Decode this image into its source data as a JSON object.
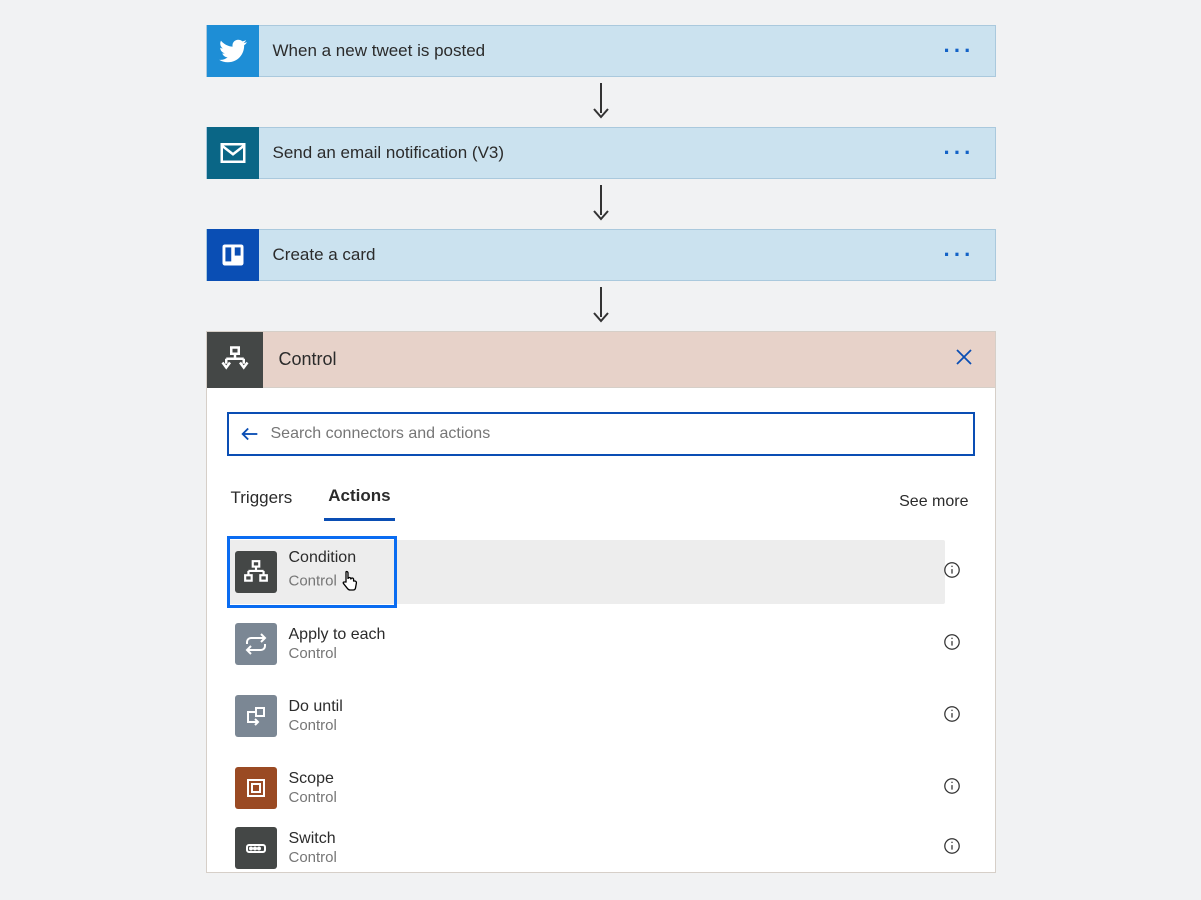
{
  "steps": [
    {
      "label": "When a new tweet is posted",
      "icon": "twitter",
      "bg": "#1e8ed6"
    },
    {
      "label": "Send an email notification (V3)",
      "icon": "mail",
      "bg": "#0a6686"
    },
    {
      "label": "Create a card",
      "icon": "trello",
      "bg": "#0a4eb4"
    }
  ],
  "panel": {
    "title": "Control",
    "search_placeholder": "Search connectors and actions",
    "tabs": {
      "triggers": "Triggers",
      "actions": "Actions"
    },
    "see_more": "See more"
  },
  "actions": [
    {
      "name": "Condition",
      "category": "Control",
      "icon": "condition",
      "bg": "#444746",
      "selected": true
    },
    {
      "name": "Apply to each",
      "category": "Control",
      "icon": "loop",
      "bg": "#7b8794",
      "selected": false
    },
    {
      "name": "Do until",
      "category": "Control",
      "icon": "dountil",
      "bg": "#7b8794",
      "selected": false
    },
    {
      "name": "Scope",
      "category": "Control",
      "icon": "scope",
      "bg": "#9a4a23",
      "selected": false
    },
    {
      "name": "Switch",
      "category": "Control",
      "icon": "switch",
      "bg": "#444746",
      "selected": false
    }
  ]
}
